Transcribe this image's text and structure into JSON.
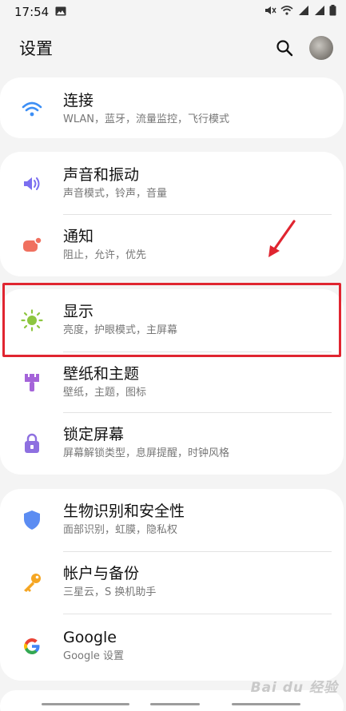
{
  "status_bar": {
    "time": "17:54",
    "icons": [
      "image-icon",
      "mute-icon",
      "wifi-icon",
      "signal-4g-icon",
      "signal-icon",
      "battery-icon"
    ]
  },
  "header": {
    "title": "设置",
    "search_icon": "search-icon",
    "avatar": "avatar"
  },
  "sections": [
    {
      "items": [
        {
          "id": "connections",
          "title": "连接",
          "subtitle": "WLAN，蓝牙，流量监控，飞行模式",
          "icon": "wifi-icon",
          "icon_color": "#3d8ff5"
        }
      ]
    },
    {
      "items": [
        {
          "id": "sounds",
          "title": "声音和振动",
          "subtitle": "声音模式，铃声，音量",
          "icon": "speaker-icon",
          "icon_color": "#7b6ef0"
        },
        {
          "id": "notifications",
          "title": "通知",
          "subtitle": "阻止，允许，优先",
          "icon": "notification-icon",
          "icon_color": "#f0705f"
        }
      ]
    },
    {
      "items": [
        {
          "id": "display",
          "title": "显示",
          "subtitle": "亮度，护眼模式，主屏幕",
          "icon": "sun-icon",
          "icon_color": "#8dc63f"
        },
        {
          "id": "wallpaper",
          "title": "壁纸和主题",
          "subtitle": "壁纸，主题，图标",
          "icon": "brush-icon",
          "icon_color": "#a564d9"
        },
        {
          "id": "lockscreen",
          "title": "锁定屏幕",
          "subtitle": "屏幕解锁类型，息屏提醒，时钟风格",
          "icon": "lock-icon",
          "icon_color": "#8e70e0"
        }
      ]
    },
    {
      "items": [
        {
          "id": "biometrics",
          "title": "生物识别和安全性",
          "subtitle": "面部识别，虹膜，隐私权",
          "icon": "shield-icon",
          "icon_color": "#5b8cf2"
        },
        {
          "id": "accounts",
          "title": "帐户与备份",
          "subtitle": "三星云，S 换机助手",
          "icon": "key-icon",
          "icon_color": "#f5a623"
        },
        {
          "id": "google",
          "title": "Google",
          "subtitle": "Google 设置",
          "icon": "google-icon",
          "icon_color": "#4285f4"
        }
      ]
    }
  ],
  "annotation": {
    "highlight_color": "#e02530",
    "arrow_color": "#e02530"
  },
  "watermark": "Bai du 经验"
}
